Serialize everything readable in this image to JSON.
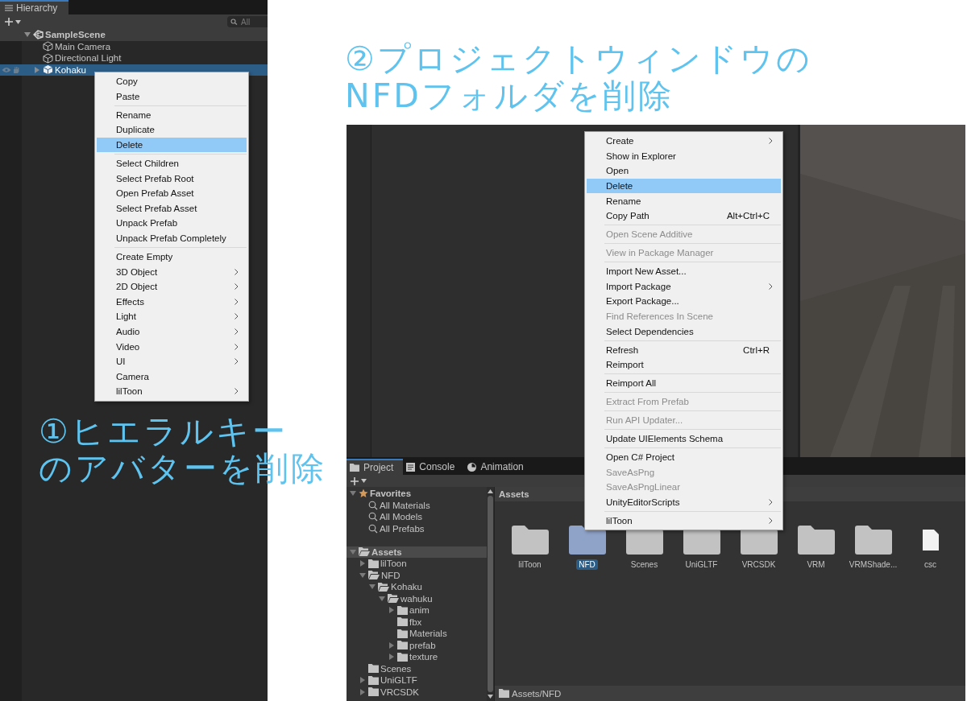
{
  "hierarchy": {
    "tab": "Hierarchy",
    "search": {
      "placeholder": "All"
    },
    "tree": [
      {
        "label": "SampleScene",
        "kind": "scene",
        "expanded": true,
        "selected": false,
        "children": [
          {
            "label": "Main Camera",
            "kind": "object",
            "selected": false
          },
          {
            "label": "Directional Light",
            "kind": "object",
            "selected": false
          },
          {
            "label": "Kohaku",
            "kind": "prefab",
            "expanded": false,
            "selected": true
          }
        ]
      }
    ]
  },
  "hierarchy_menu": {
    "groups": [
      [
        {
          "label": "Copy",
          "selected": false,
          "submenu": false
        },
        {
          "label": "Paste",
          "selected": false,
          "submenu": false
        }
      ],
      [
        {
          "label": "Rename",
          "selected": false,
          "submenu": false
        },
        {
          "label": "Duplicate",
          "selected": false,
          "submenu": false
        },
        {
          "label": "Delete",
          "selected": true,
          "submenu": false
        }
      ],
      [
        {
          "label": "Select Children",
          "selected": false,
          "submenu": false
        },
        {
          "label": "Select Prefab Root",
          "selected": false,
          "submenu": false
        },
        {
          "label": "Open Prefab Asset",
          "selected": false,
          "submenu": false
        },
        {
          "label": "Select Prefab Asset",
          "selected": false,
          "submenu": false
        },
        {
          "label": "Unpack Prefab",
          "selected": false,
          "submenu": false
        },
        {
          "label": "Unpack Prefab Completely",
          "selected": false,
          "submenu": false
        }
      ],
      [
        {
          "label": "Create Empty",
          "selected": false,
          "submenu": false
        },
        {
          "label": "3D Object",
          "selected": false,
          "submenu": true
        },
        {
          "label": "2D Object",
          "selected": false,
          "submenu": true
        },
        {
          "label": "Effects",
          "selected": false,
          "submenu": true
        },
        {
          "label": "Light",
          "selected": false,
          "submenu": true
        },
        {
          "label": "Audio",
          "selected": false,
          "submenu": true
        },
        {
          "label": "Video",
          "selected": false,
          "submenu": true
        },
        {
          "label": "UI",
          "selected": false,
          "submenu": true
        },
        {
          "label": "Camera",
          "selected": false,
          "submenu": false
        },
        {
          "label": "lilToon",
          "selected": false,
          "submenu": true
        }
      ]
    ]
  },
  "annotations": [
    {
      "lines": [
        "①ヒエラルキー",
        "のアバターを削除"
      ]
    },
    {
      "lines": [
        "②プロジェクトウィンドウの",
        "NFDフォルダを削除"
      ]
    }
  ],
  "project": {
    "tabs": [
      {
        "label": "Project",
        "kind": "folder",
        "selected": true
      },
      {
        "label": "Console",
        "kind": "console",
        "selected": false
      },
      {
        "label": "Animation",
        "kind": "animation",
        "selected": false
      }
    ],
    "tree": [
      {
        "label": "Favorites",
        "kind": "favorites",
        "selected": false,
        "expanded": true,
        "children": [
          {
            "label": "All Materials",
            "kind": "search",
            "selected": false
          },
          {
            "label": "All Models",
            "kind": "search",
            "selected": false
          },
          {
            "label": "All Prefabs",
            "kind": "search",
            "selected": false
          }
        ]
      },
      {
        "label": "Assets",
        "kind": "root",
        "selected": true,
        "expanded": true,
        "children": [
          {
            "label": "lilToon",
            "kind": "folder",
            "selected": false,
            "expanded": false
          },
          {
            "label": "NFD",
            "kind": "folder",
            "selected": false,
            "expanded": true,
            "children": [
              {
                "label": "Kohaku",
                "kind": "folder",
                "selected": false,
                "expanded": true,
                "children": [
                  {
                    "label": "wahuku",
                    "kind": "folder",
                    "selected": false,
                    "expanded": true,
                    "children": [
                      {
                        "label": "anim",
                        "kind": "folder",
                        "selected": false,
                        "expanded": false
                      },
                      {
                        "label": "fbx",
                        "kind": "folder",
                        "selected": false
                      },
                      {
                        "label": "Materials",
                        "kind": "folder",
                        "selected": false
                      },
                      {
                        "label": "prefab",
                        "kind": "folder",
                        "selected": false,
                        "expanded": false
                      },
                      {
                        "label": "texture",
                        "kind": "folder",
                        "selected": false,
                        "expanded": false
                      }
                    ]
                  }
                ]
              }
            ]
          },
          {
            "label": "Scenes",
            "kind": "folder",
            "selected": false
          },
          {
            "label": "UniGLTF",
            "kind": "folder",
            "selected": false,
            "expanded": false
          },
          {
            "label": "VRCSDK",
            "kind": "folder",
            "selected": false,
            "expanded": false
          }
        ]
      }
    ],
    "breadcrumb": "Assets",
    "assets": [
      {
        "label": "lilToon",
        "kind": "folder",
        "selected": false
      },
      {
        "label": "NFD",
        "kind": "folder",
        "selected": true
      },
      {
        "label": "Scenes",
        "kind": "folder",
        "selected": false
      },
      {
        "label": "UniGLTF",
        "kind": "folder",
        "selected": false
      },
      {
        "label": "VRCSDK",
        "kind": "folder",
        "selected": false
      },
      {
        "label": "VRM",
        "kind": "folder",
        "selected": false
      },
      {
        "label": "VRMShade...",
        "kind": "folder",
        "selected": false
      },
      {
        "label": "csc",
        "kind": "file",
        "selected": false
      }
    ],
    "path": "Assets/NFD"
  },
  "project_menu": {
    "groups": [
      [
        {
          "label": "Create",
          "selected": false,
          "disabled": false,
          "submenu": true
        },
        {
          "label": "Show in Explorer",
          "selected": false,
          "disabled": false,
          "submenu": false
        },
        {
          "label": "Open",
          "selected": false,
          "disabled": false,
          "submenu": false
        },
        {
          "label": "Delete",
          "selected": true,
          "disabled": false,
          "submenu": false
        },
        {
          "label": "Rename",
          "selected": false,
          "disabled": false,
          "submenu": false
        },
        {
          "label": "Copy Path",
          "shortcut": "Alt+Ctrl+C",
          "selected": false,
          "disabled": false,
          "submenu": false
        }
      ],
      [
        {
          "label": "Open Scene Additive",
          "selected": false,
          "disabled": true,
          "submenu": false
        }
      ],
      [
        {
          "label": "View in Package Manager",
          "selected": false,
          "disabled": true,
          "submenu": false
        }
      ],
      [
        {
          "label": "Import New Asset...",
          "selected": false,
          "disabled": false,
          "submenu": false
        },
        {
          "label": "Import Package",
          "selected": false,
          "disabled": false,
          "submenu": true
        },
        {
          "label": "Export Package...",
          "selected": false,
          "disabled": false,
          "submenu": false
        },
        {
          "label": "Find References In Scene",
          "selected": false,
          "disabled": true,
          "submenu": false
        },
        {
          "label": "Select Dependencies",
          "selected": false,
          "disabled": false,
          "submenu": false
        }
      ],
      [
        {
          "label": "Refresh",
          "shortcut": "Ctrl+R",
          "selected": false,
          "disabled": false,
          "submenu": false
        },
        {
          "label": "Reimport",
          "selected": false,
          "disabled": false,
          "submenu": false
        }
      ],
      [
        {
          "label": "Reimport All",
          "selected": false,
          "disabled": false,
          "submenu": false
        }
      ],
      [
        {
          "label": "Extract From Prefab",
          "selected": false,
          "disabled": true,
          "submenu": false
        }
      ],
      [
        {
          "label": "Run API Updater...",
          "selected": false,
          "disabled": true,
          "submenu": false
        }
      ],
      [
        {
          "label": "Update UIElements Schema",
          "selected": false,
          "disabled": false,
          "submenu": false
        }
      ],
      [
        {
          "label": "Open C# Project",
          "selected": false,
          "disabled": false,
          "submenu": false
        },
        {
          "label": "SaveAsPng",
          "selected": false,
          "disabled": true,
          "submenu": false
        },
        {
          "label": "SaveAsPngLinear",
          "selected": false,
          "disabled": true,
          "submenu": false
        },
        {
          "label": "UnityEditorScripts",
          "selected": false,
          "disabled": false,
          "submenu": true
        }
      ],
      [
        {
          "label": "lilToon",
          "selected": false,
          "disabled": false,
          "submenu": true
        }
      ]
    ]
  }
}
